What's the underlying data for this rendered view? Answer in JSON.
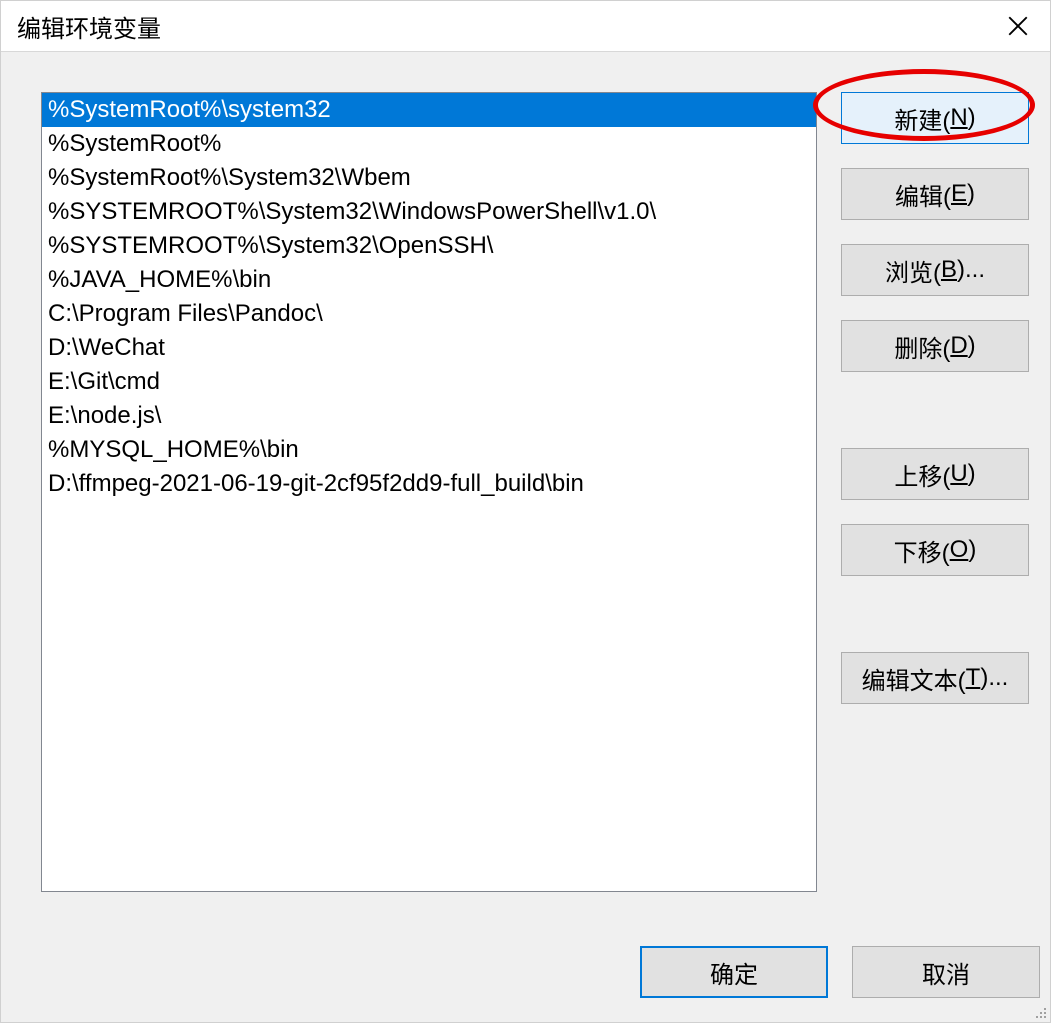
{
  "dialog": {
    "title": "编辑环境变量"
  },
  "list": {
    "selectedIndex": 0,
    "items": [
      "%SystemRoot%\\system32",
      "%SystemRoot%",
      "%SystemRoot%\\System32\\Wbem",
      "%SYSTEMROOT%\\System32\\WindowsPowerShell\\v1.0\\",
      "%SYSTEMROOT%\\System32\\OpenSSH\\",
      "%JAVA_HOME%\\bin",
      "C:\\Program Files\\Pandoc\\",
      "D:\\WeChat",
      "E:\\Git\\cmd",
      "E:\\node.js\\",
      "%MYSQL_HOME%\\bin",
      "D:\\ffmpeg-2021-06-19-git-2cf95f2dd9-full_build\\bin"
    ]
  },
  "buttons": {
    "new_prefix": "新建(",
    "new_hotkey": "N",
    "new_suffix": ")",
    "edit_prefix": "编辑(",
    "edit_hotkey": "E",
    "edit_suffix": ")",
    "browse_prefix": "浏览(",
    "browse_hotkey": "B",
    "browse_suffix": ")...",
    "delete_prefix": "删除(",
    "delete_hotkey": "D",
    "delete_suffix": ")",
    "moveup_prefix": "上移(",
    "moveup_hotkey": "U",
    "moveup_suffix": ")",
    "movedown_prefix": "下移(",
    "movedown_hotkey": "O",
    "movedown_suffix": ")",
    "edittext_prefix": "编辑文本(",
    "edittext_hotkey": "T",
    "edittext_suffix": ")...",
    "ok": "确定",
    "cancel": "取消"
  },
  "annotation": {
    "highlight_target": "new-button"
  }
}
